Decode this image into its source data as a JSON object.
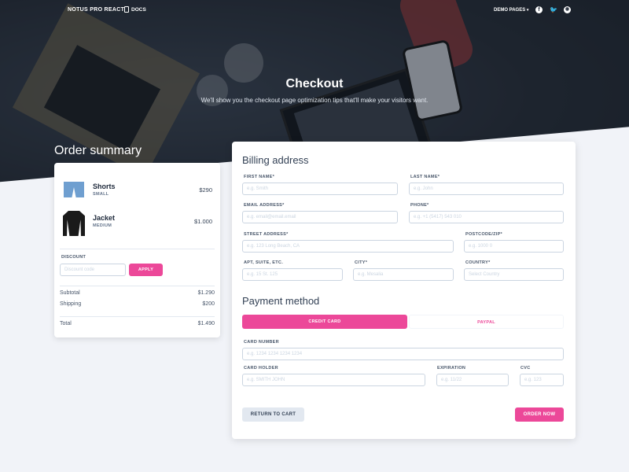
{
  "nav": {
    "brand": "NOTUS PRO REACT",
    "docs_label": "DOCS",
    "demo_pages": "DEMO PAGES",
    "social": [
      "facebook-icon",
      "twitter-icon",
      "github-icon"
    ]
  },
  "hero": {
    "title": "Checkout",
    "subtitle": "We'll show you the checkout page optimization tips that'll make your visitors want."
  },
  "summary": {
    "title": "Order summary",
    "items": [
      {
        "name": "Shorts",
        "variant": "SMALL",
        "price": "$290"
      },
      {
        "name": "Jacket",
        "variant": "MEDIUM",
        "price": "$1.000"
      }
    ],
    "discount_label": "DISCOUNT",
    "discount_placeholder": "Discount code",
    "apply_label": "APPLY",
    "subtotal_label": "Subtotal",
    "subtotal_value": "$1.290",
    "shipping_label": "Shipping",
    "shipping_value": "$200",
    "total_label": "Total",
    "total_value": "$1.490"
  },
  "billing": {
    "title": "Billing address",
    "fields": {
      "first_name": {
        "label": "FIRST NAME*",
        "placeholder": "e.g. Smith"
      },
      "last_name": {
        "label": "LAST NAME*",
        "placeholder": "e.g. John"
      },
      "email": {
        "label": "EMAIL ADDRESS*",
        "placeholder": "e.g. email@email.email"
      },
      "phone": {
        "label": "PHONE*",
        "placeholder": "e.g. +1 (5417) 543 010"
      },
      "street": {
        "label": "STREET ADDRESS*",
        "placeholder": "e.g. 123 Long Beach, CA"
      },
      "postcode": {
        "label": "POSTCODE/ZIP*",
        "placeholder": "e.g. 1000 0"
      },
      "apt": {
        "label": "APT, SUITE, ETC.",
        "placeholder": "e.g. 15 St. 125"
      },
      "city": {
        "label": "CITY*",
        "placeholder": "e.g. Mesalia"
      },
      "country": {
        "label": "COUNTRY*",
        "placeholder": "Select Country"
      }
    }
  },
  "payment": {
    "title": "Payment method",
    "tabs": [
      {
        "label": "CREDIT CARD",
        "active": true
      },
      {
        "label": "PAYPAL",
        "active": false
      }
    ],
    "fields": {
      "card_number": {
        "label": "CARD NUMBER",
        "placeholder": "e.g. 1234 1234 1234 1234"
      },
      "card_holder": {
        "label": "CARD HOLDER",
        "placeholder": "e.g. SMITH JOHN"
      },
      "expiration": {
        "label": "EXPIRATION",
        "placeholder": "e.g. 11/22"
      },
      "cvc": {
        "label": "CVC",
        "placeholder": "e.g. 123"
      }
    }
  },
  "actions": {
    "return_label": "RETURN TO CART",
    "order_label": "ORDER NOW"
  },
  "colors": {
    "accent": "#ec4899",
    "hero_bg": "#262d38",
    "page_bg": "#f1f3f8"
  }
}
